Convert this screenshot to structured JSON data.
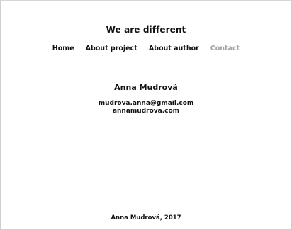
{
  "site": {
    "title": "We are different"
  },
  "nav": {
    "items": [
      {
        "label": "Home",
        "active": false
      },
      {
        "label": "About project",
        "active": false
      },
      {
        "label": "About author",
        "active": false
      },
      {
        "label": "Contact",
        "active": true
      }
    ]
  },
  "contact": {
    "name": "Anna Mudrová",
    "email": "mudrova.anna@gmail.com",
    "website": "annamudrova.com"
  },
  "footer": {
    "text": "Anna Mudrová, 2017"
  },
  "colors": {
    "text": "#111111",
    "muted_nav": "#a3a3a3",
    "background": "#ffffff"
  }
}
